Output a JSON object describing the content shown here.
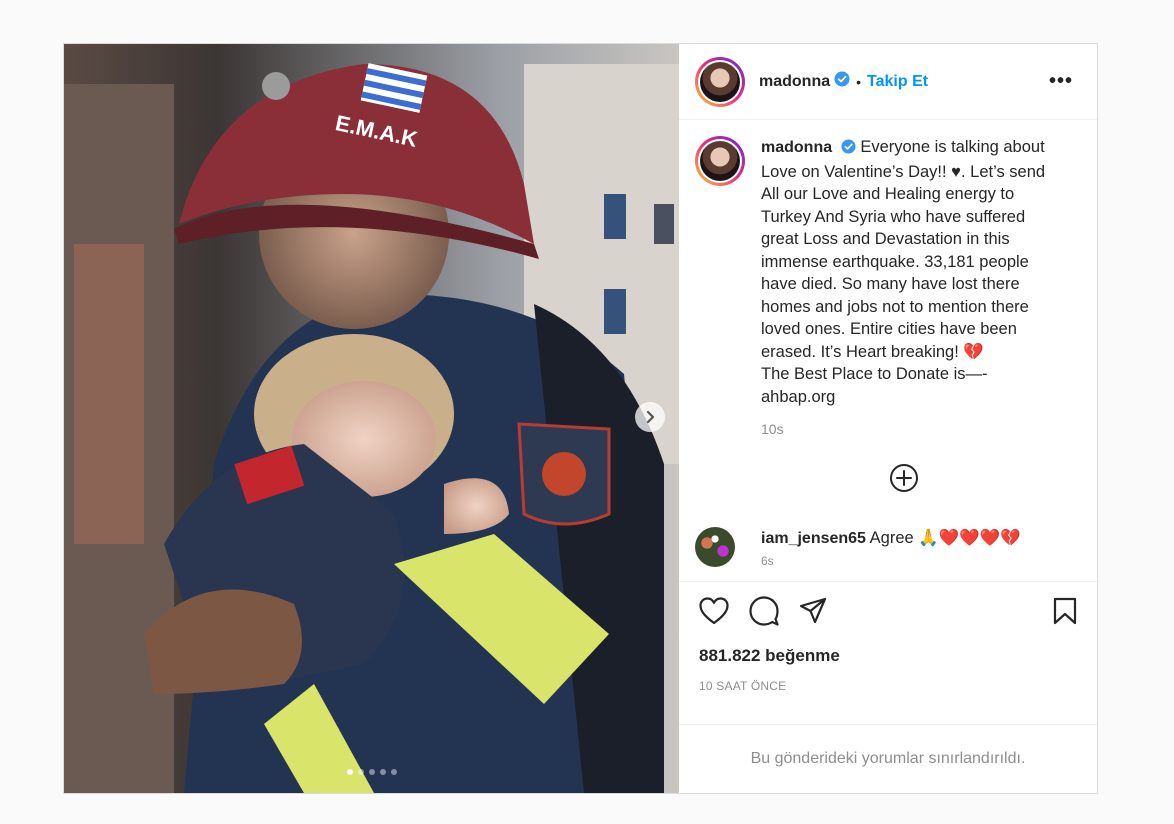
{
  "post": {
    "username": "madonna",
    "follow_label": "Takip Et",
    "separator": "•",
    "more_label": "•••",
    "helmet_text": "E.M.A.K",
    "caption_lines": [
      "Everyone is talking about",
      "Love  on Valentine’s Day!! ♥. Let’s send",
      "All our Love and Healing  energy to",
      "Turkey And Syria who have suffered",
      "great Loss and Devastation in this",
      "immense earthquake.  33,181 people",
      "have died.  So many  have lost there",
      "homes and jobs not to mention there",
      "loved ones. Entire cities have been",
      "erased. It’s Heart breaking! 💔",
      "The Best Place to Donate is—-",
      "ahbap.org"
    ],
    "caption_time": "10s",
    "comment": {
      "username": "iam_jensen65",
      "text": "Agree 🙏❤️❤️❤️💔",
      "time": "6s"
    },
    "likes": "881.822 beğenme",
    "time_ago": "10 SAAT ÖNCE",
    "comments_limited": "Bu gönderideki yorumlar sınırlandırıldı.",
    "carousel": {
      "total": 5,
      "active": 1
    }
  },
  "colors": {
    "accent": "#0095f6",
    "verified": "#3897f0",
    "muted": "#8e8e8e"
  }
}
